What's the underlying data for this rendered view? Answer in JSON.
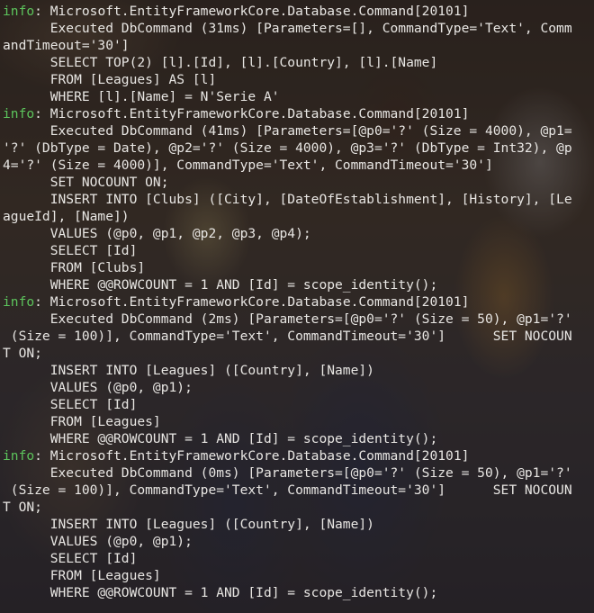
{
  "terminal": {
    "lines": [
      {
        "tag": "info",
        "text": ": Microsoft.EntityFrameworkCore.Database.Command[20101]"
      },
      {
        "tag": "",
        "text": "      Executed DbCommand (31ms) [Parameters=[], CommandType='Text', Comm"
      },
      {
        "tag": "",
        "text": "andTimeout='30']"
      },
      {
        "tag": "",
        "text": "      SELECT TOP(2) [l].[Id], [l].[Country], [l].[Name]"
      },
      {
        "tag": "",
        "text": "      FROM [Leagues] AS [l]"
      },
      {
        "tag": "",
        "text": "      WHERE [l].[Name] = N'Serie A'"
      },
      {
        "tag": "info",
        "text": ": Microsoft.EntityFrameworkCore.Database.Command[20101]"
      },
      {
        "tag": "",
        "text": "      Executed DbCommand (41ms) [Parameters=[@p0='?' (Size = 4000), @p1="
      },
      {
        "tag": "",
        "text": "'?' (DbType = Date), @p2='?' (Size = 4000), @p3='?' (DbType = Int32), @p"
      },
      {
        "tag": "",
        "text": "4='?' (Size = 4000)], CommandType='Text', CommandTimeout='30']"
      },
      {
        "tag": "",
        "text": "      SET NOCOUNT ON;"
      },
      {
        "tag": "",
        "text": "      INSERT INTO [Clubs] ([City], [DateOfEstablishment], [History], [Le"
      },
      {
        "tag": "",
        "text": "agueId], [Name])"
      },
      {
        "tag": "",
        "text": "      VALUES (@p0, @p1, @p2, @p3, @p4);"
      },
      {
        "tag": "",
        "text": "      SELECT [Id]"
      },
      {
        "tag": "",
        "text": "      FROM [Clubs]"
      },
      {
        "tag": "",
        "text": "      WHERE @@ROWCOUNT = 1 AND [Id] = scope_identity();"
      },
      {
        "tag": "info",
        "text": ": Microsoft.EntityFrameworkCore.Database.Command[20101]"
      },
      {
        "tag": "",
        "text": "      Executed DbCommand (2ms) [Parameters=[@p0='?' (Size = 50), @p1='?'"
      },
      {
        "tag": "",
        "text": " (Size = 100)], CommandType='Text', CommandTimeout='30']      SET NOCOUN"
      },
      {
        "tag": "",
        "text": "T ON;"
      },
      {
        "tag": "",
        "text": "      INSERT INTO [Leagues] ([Country], [Name])"
      },
      {
        "tag": "",
        "text": "      VALUES (@p0, @p1);"
      },
      {
        "tag": "",
        "text": "      SELECT [Id]"
      },
      {
        "tag": "",
        "text": "      FROM [Leagues]"
      },
      {
        "tag": "",
        "text": "      WHERE @@ROWCOUNT = 1 AND [Id] = scope_identity();"
      },
      {
        "tag": "info",
        "text": ": Microsoft.EntityFrameworkCore.Database.Command[20101]"
      },
      {
        "tag": "",
        "text": "      Executed DbCommand (0ms) [Parameters=[@p0='?' (Size = 50), @p1='?'"
      },
      {
        "tag": "",
        "text": " (Size = 100)], CommandType='Text', CommandTimeout='30']      SET NOCOUN"
      },
      {
        "tag": "",
        "text": "T ON;"
      },
      {
        "tag": "",
        "text": "      INSERT INTO [Leagues] ([Country], [Name])"
      },
      {
        "tag": "",
        "text": "      VALUES (@p0, @p1);"
      },
      {
        "tag": "",
        "text": "      SELECT [Id]"
      },
      {
        "tag": "",
        "text": "      FROM [Leagues]"
      },
      {
        "tag": "",
        "text": "      WHERE @@ROWCOUNT = 1 AND [Id] = scope_identity();"
      }
    ]
  },
  "colors": {
    "text": "#e8e6e3",
    "info_tag": "#5cc45c"
  }
}
